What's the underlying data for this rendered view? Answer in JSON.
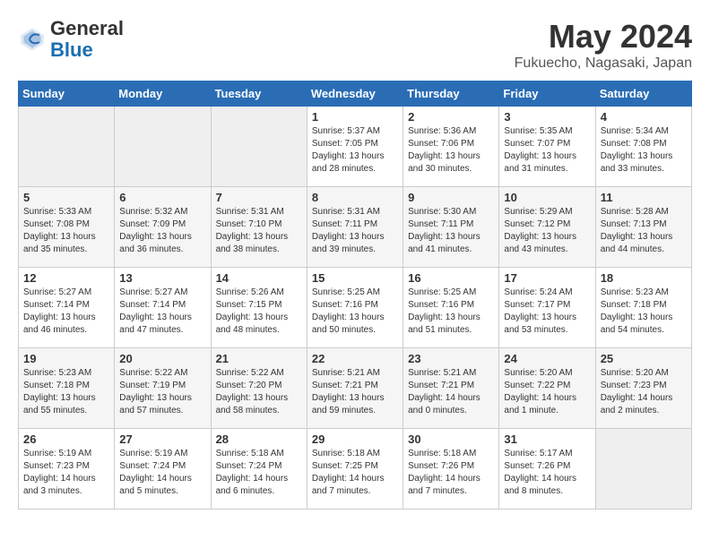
{
  "header": {
    "logo_line1": "General",
    "logo_line2": "Blue",
    "month": "May 2024",
    "location": "Fukuecho, Nagasaki, Japan"
  },
  "days_of_week": [
    "Sunday",
    "Monday",
    "Tuesday",
    "Wednesday",
    "Thursday",
    "Friday",
    "Saturday"
  ],
  "weeks": [
    [
      {
        "day": "",
        "info": ""
      },
      {
        "day": "",
        "info": ""
      },
      {
        "day": "",
        "info": ""
      },
      {
        "day": "1",
        "info": "Sunrise: 5:37 AM\nSunset: 7:05 PM\nDaylight: 13 hours\nand 28 minutes."
      },
      {
        "day": "2",
        "info": "Sunrise: 5:36 AM\nSunset: 7:06 PM\nDaylight: 13 hours\nand 30 minutes."
      },
      {
        "day": "3",
        "info": "Sunrise: 5:35 AM\nSunset: 7:07 PM\nDaylight: 13 hours\nand 31 minutes."
      },
      {
        "day": "4",
        "info": "Sunrise: 5:34 AM\nSunset: 7:08 PM\nDaylight: 13 hours\nand 33 minutes."
      }
    ],
    [
      {
        "day": "5",
        "info": "Sunrise: 5:33 AM\nSunset: 7:08 PM\nDaylight: 13 hours\nand 35 minutes."
      },
      {
        "day": "6",
        "info": "Sunrise: 5:32 AM\nSunset: 7:09 PM\nDaylight: 13 hours\nand 36 minutes."
      },
      {
        "day": "7",
        "info": "Sunrise: 5:31 AM\nSunset: 7:10 PM\nDaylight: 13 hours\nand 38 minutes."
      },
      {
        "day": "8",
        "info": "Sunrise: 5:31 AM\nSunset: 7:11 PM\nDaylight: 13 hours\nand 39 minutes."
      },
      {
        "day": "9",
        "info": "Sunrise: 5:30 AM\nSunset: 7:11 PM\nDaylight: 13 hours\nand 41 minutes."
      },
      {
        "day": "10",
        "info": "Sunrise: 5:29 AM\nSunset: 7:12 PM\nDaylight: 13 hours\nand 43 minutes."
      },
      {
        "day": "11",
        "info": "Sunrise: 5:28 AM\nSunset: 7:13 PM\nDaylight: 13 hours\nand 44 minutes."
      }
    ],
    [
      {
        "day": "12",
        "info": "Sunrise: 5:27 AM\nSunset: 7:14 PM\nDaylight: 13 hours\nand 46 minutes."
      },
      {
        "day": "13",
        "info": "Sunrise: 5:27 AM\nSunset: 7:14 PM\nDaylight: 13 hours\nand 47 minutes."
      },
      {
        "day": "14",
        "info": "Sunrise: 5:26 AM\nSunset: 7:15 PM\nDaylight: 13 hours\nand 48 minutes."
      },
      {
        "day": "15",
        "info": "Sunrise: 5:25 AM\nSunset: 7:16 PM\nDaylight: 13 hours\nand 50 minutes."
      },
      {
        "day": "16",
        "info": "Sunrise: 5:25 AM\nSunset: 7:16 PM\nDaylight: 13 hours\nand 51 minutes."
      },
      {
        "day": "17",
        "info": "Sunrise: 5:24 AM\nSunset: 7:17 PM\nDaylight: 13 hours\nand 53 minutes."
      },
      {
        "day": "18",
        "info": "Sunrise: 5:23 AM\nSunset: 7:18 PM\nDaylight: 13 hours\nand 54 minutes."
      }
    ],
    [
      {
        "day": "19",
        "info": "Sunrise: 5:23 AM\nSunset: 7:18 PM\nDaylight: 13 hours\nand 55 minutes."
      },
      {
        "day": "20",
        "info": "Sunrise: 5:22 AM\nSunset: 7:19 PM\nDaylight: 13 hours\nand 57 minutes."
      },
      {
        "day": "21",
        "info": "Sunrise: 5:22 AM\nSunset: 7:20 PM\nDaylight: 13 hours\nand 58 minutes."
      },
      {
        "day": "22",
        "info": "Sunrise: 5:21 AM\nSunset: 7:21 PM\nDaylight: 13 hours\nand 59 minutes."
      },
      {
        "day": "23",
        "info": "Sunrise: 5:21 AM\nSunset: 7:21 PM\nDaylight: 14 hours\nand 0 minutes."
      },
      {
        "day": "24",
        "info": "Sunrise: 5:20 AM\nSunset: 7:22 PM\nDaylight: 14 hours\nand 1 minute."
      },
      {
        "day": "25",
        "info": "Sunrise: 5:20 AM\nSunset: 7:23 PM\nDaylight: 14 hours\nand 2 minutes."
      }
    ],
    [
      {
        "day": "26",
        "info": "Sunrise: 5:19 AM\nSunset: 7:23 PM\nDaylight: 14 hours\nand 3 minutes."
      },
      {
        "day": "27",
        "info": "Sunrise: 5:19 AM\nSunset: 7:24 PM\nDaylight: 14 hours\nand 5 minutes."
      },
      {
        "day": "28",
        "info": "Sunrise: 5:18 AM\nSunset: 7:24 PM\nDaylight: 14 hours\nand 6 minutes."
      },
      {
        "day": "29",
        "info": "Sunrise: 5:18 AM\nSunset: 7:25 PM\nDaylight: 14 hours\nand 7 minutes."
      },
      {
        "day": "30",
        "info": "Sunrise: 5:18 AM\nSunset: 7:26 PM\nDaylight: 14 hours\nand 7 minutes."
      },
      {
        "day": "31",
        "info": "Sunrise: 5:17 AM\nSunset: 7:26 PM\nDaylight: 14 hours\nand 8 minutes."
      },
      {
        "day": "",
        "info": ""
      }
    ]
  ]
}
